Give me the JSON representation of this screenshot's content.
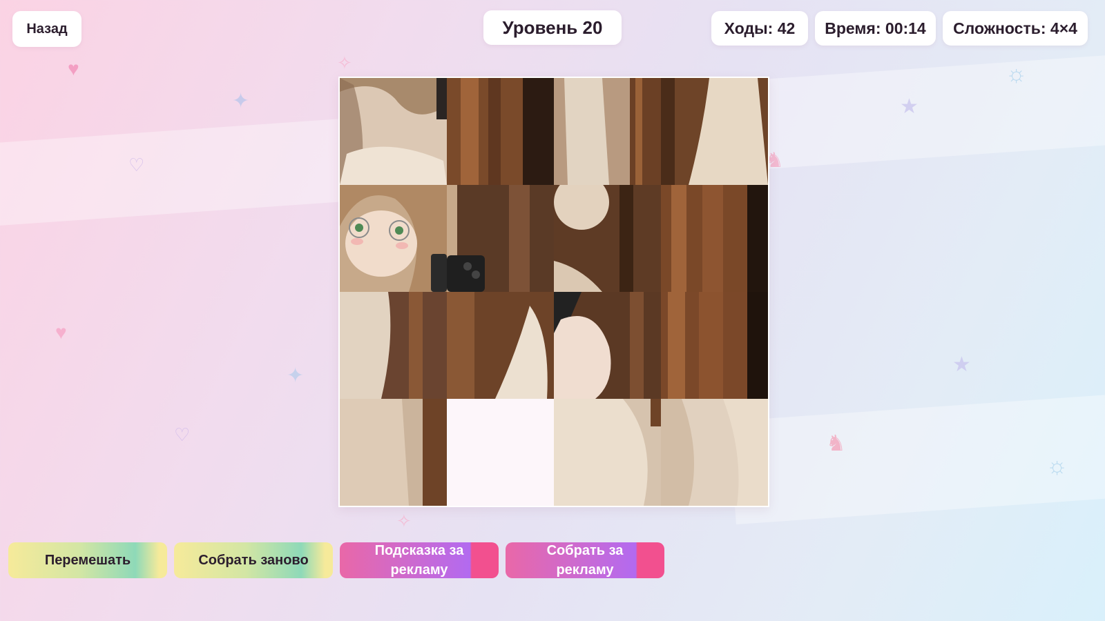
{
  "header": {
    "back_label": "Назад",
    "level_label": "Уровень 20",
    "moves_label": "Ходы: 42",
    "time_label": "Время: 00:14",
    "difficulty_label": "Сложность: 4×4"
  },
  "board": {
    "grid_size": 4,
    "empty_row": 3,
    "empty_col": 1
  },
  "actions": {
    "shuffle_label": "Перемешать",
    "reset_label": "Собрать заново",
    "hint_ad_label": "Подсказка за рекламу",
    "solve_ad_label": "Собрать за рекламу"
  },
  "decorations": [
    "heart-icon",
    "heart-outline-icon",
    "sparkle-icon",
    "star-icon",
    "sun-icon",
    "chess-knight-icon"
  ],
  "colors": {
    "accent_pink": "#e968a8",
    "accent_purple": "#b26af0",
    "accent_green": "#8ed9b8",
    "accent_yellow": "#f6ea9a",
    "text_dark": "#2b1d2d"
  }
}
